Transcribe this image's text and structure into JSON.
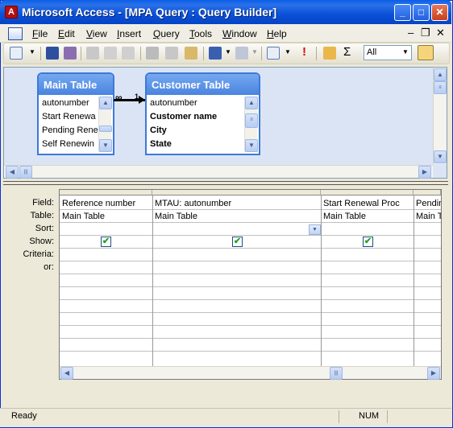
{
  "window": {
    "title": "Microsoft Access - [MPA Query : Query Builder]",
    "app_icon": "access-key-icon"
  },
  "title_buttons": {
    "minimize": "_",
    "maximize": "□",
    "close": "✕"
  },
  "menu": {
    "items": [
      "File",
      "Edit",
      "View",
      "Insert",
      "Query",
      "Tools",
      "Window",
      "Help"
    ],
    "mdi_controls": {
      "minimize": "–",
      "restore": "❐",
      "close": "✕"
    }
  },
  "toolbar": {
    "top_values_combo": "All",
    "sum_glyph": "Σ",
    "run_glyph": "!"
  },
  "tables": {
    "main": {
      "title": "Main Table",
      "fields": [
        "autonumber",
        "Start Renewa",
        "Pending Rene",
        "Self Renewin"
      ]
    },
    "customer": {
      "title": "Customer Table",
      "fields": [
        "autonumber",
        "Customer name",
        "City",
        "State"
      ]
    },
    "join": {
      "many": "∞",
      "one": "1"
    }
  },
  "grid": {
    "row_labels": [
      "Field:",
      "Table:",
      "Sort:",
      "Show:",
      "Criteria:",
      "or:"
    ],
    "columns": [
      {
        "field": "Reference number",
        "table": "Main Table",
        "show": true
      },
      {
        "field": "MTAU: autonumber",
        "table": "Main Table",
        "show": true
      },
      {
        "field": "Start Renewal Proc",
        "table": "Main Table",
        "show": true
      },
      {
        "field": "Pendin",
        "table": "Main T",
        "show": null
      }
    ],
    "check_glyph": "✔"
  },
  "status": {
    "left": "Ready",
    "num": "NUM"
  },
  "colors": {
    "title_blue": "#0a5fe8",
    "pane_blue": "#dbe4f4",
    "close_red": "#c7401c"
  }
}
